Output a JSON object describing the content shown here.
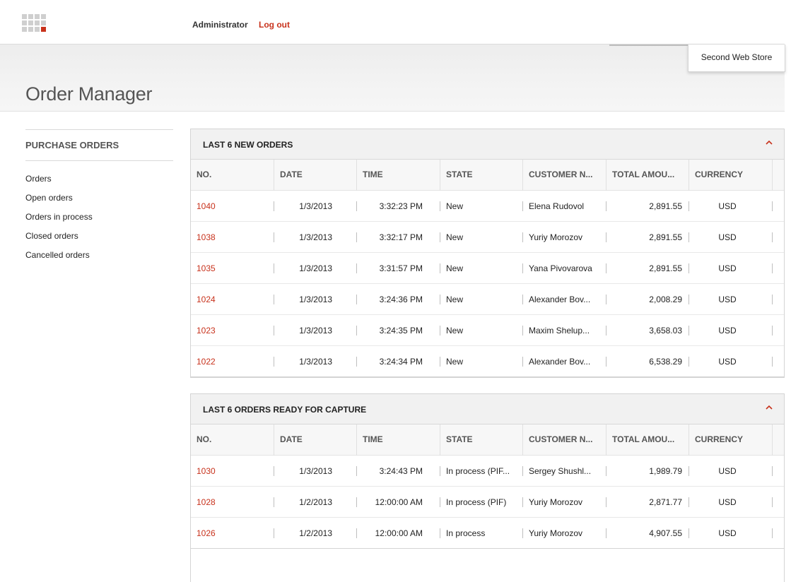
{
  "topbar": {
    "user": "Administrator",
    "logout": "Log out"
  },
  "header": {
    "store": "Second Web Store",
    "title": "Order Manager"
  },
  "sidebar": {
    "heading": "PURCHASE ORDERS",
    "items": [
      "Orders",
      "Open orders",
      "Orders in process",
      "Closed orders",
      "Cancelled orders"
    ]
  },
  "columns": [
    "NO.",
    "DATE",
    "TIME",
    "STATE",
    "CUSTOMER N...",
    "TOTAL AMOU...",
    "CURRENCY"
  ],
  "panels": [
    {
      "title": "LAST 6 NEW ORDERS",
      "rows": [
        {
          "no": "1040",
          "date": "1/3/2013",
          "time": "3:32:23 PM",
          "state": "New",
          "customer": "Elena Rudovol",
          "total": "2,891.55",
          "currency": "USD"
        },
        {
          "no": "1038",
          "date": "1/3/2013",
          "time": "3:32:17 PM",
          "state": "New",
          "customer": "Yuriy Morozov",
          "total": "2,891.55",
          "currency": "USD"
        },
        {
          "no": "1035",
          "date": "1/3/2013",
          "time": "3:31:57 PM",
          "state": "New",
          "customer": "Yana Pivovarova",
          "total": "2,891.55",
          "currency": "USD"
        },
        {
          "no": "1024",
          "date": "1/3/2013",
          "time": "3:24:36 PM",
          "state": "New",
          "customer": "Alexander Bov...",
          "total": "2,008.29",
          "currency": "USD"
        },
        {
          "no": "1023",
          "date": "1/3/2013",
          "time": "3:24:35 PM",
          "state": "New",
          "customer": "Maxim Shelup...",
          "total": "3,658.03",
          "currency": "USD"
        },
        {
          "no": "1022",
          "date": "1/3/2013",
          "time": "3:24:34 PM",
          "state": "New",
          "customer": "Alexander Bov...",
          "total": "6,538.29",
          "currency": "USD"
        }
      ]
    },
    {
      "title": "LAST 6 ORDERS READY FOR CAPTURE",
      "rows": [
        {
          "no": "1030",
          "date": "1/3/2013",
          "time": "3:24:43 PM",
          "state": "In process (PIF...",
          "customer": "Sergey Shushl...",
          "total": "1,989.79",
          "currency": "USD"
        },
        {
          "no": "1028",
          "date": "1/2/2013",
          "time": "12:00:00 AM",
          "state": "In process (PIF)",
          "customer": "Yuriy Morozov",
          "total": "2,871.77",
          "currency": "USD"
        },
        {
          "no": "1026",
          "date": "1/2/2013",
          "time": "12:00:00 AM",
          "state": "In process",
          "customer": "Yuriy Morozov",
          "total": "4,907.55",
          "currency": "USD"
        }
      ]
    }
  ],
  "colors": {
    "accent": "#c8321c",
    "text": "#222222",
    "muted": "#555555"
  },
  "icons": {
    "logo": "grid-logo-icon",
    "collapse": "chevron-up-icon"
  }
}
